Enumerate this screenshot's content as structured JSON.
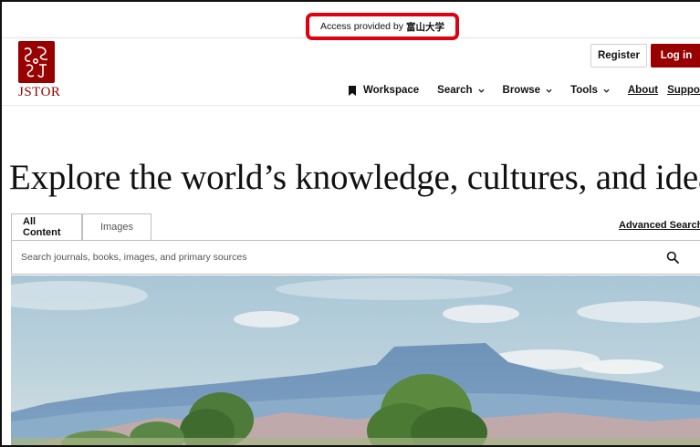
{
  "banner": {
    "access_prefix": "Access provided by",
    "institution": "富山大学"
  },
  "brand": {
    "logo_text": "JSTOR",
    "color": "#990000"
  },
  "auth": {
    "register_label": "Register",
    "login_label": "Log in"
  },
  "nav": {
    "workspace": "Workspace",
    "search": "Search",
    "browse": "Browse",
    "tools": "Tools",
    "about": "About",
    "support": "Support"
  },
  "hero": {
    "title": "Explore the world’s knowledge, cultures, and ideas"
  },
  "search": {
    "tabs": [
      "All Content",
      "Images"
    ],
    "active_tab": "All Content",
    "advanced_label": "Advanced Search",
    "placeholder": "Search journals, books, images, and primary sources",
    "value": ""
  },
  "icons": {
    "workspace": "bookmark-icon",
    "dropdown": "chevron-down-icon",
    "search": "search-icon"
  },
  "colors": {
    "accent": "#990000",
    "highlight": "#e0000f"
  }
}
